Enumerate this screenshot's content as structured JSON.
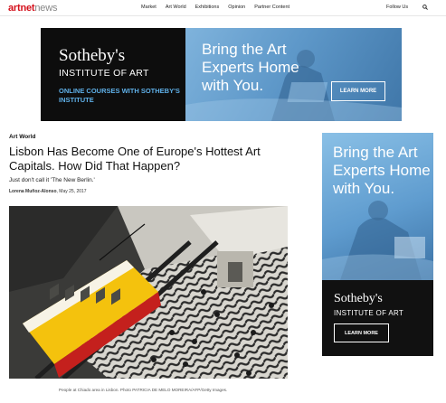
{
  "header": {
    "logo_brand": "artnet",
    "logo_section": "news",
    "nav": [
      "Market",
      "Art World",
      "Exhibitions",
      "Opinion",
      "Partner Content"
    ],
    "follow_label": "Follow Us"
  },
  "banner_ad": {
    "brand": "Sotheby's",
    "brand_sub": "INSTITUTE OF ART",
    "tagline": "ONLINE COURSES WITH SOTHEBY'S INSTITUTE",
    "headline": "Bring the Art Experts Home with You.",
    "cta": "LEARN MORE"
  },
  "article": {
    "section": "Art World",
    "headline": "Lisbon Has Become One of Europe's Hottest Art Capitals. How Did That Happen?",
    "dek": "Just don't call it 'The New Berlin.'",
    "author": "Lorena Muñoz-Alonso",
    "date": ", May 25, 2017",
    "caption": "People at Chiado area in Lisbon. Photo PATRICIA DE MELO MOREIRA/AFP/Getty Images."
  },
  "side_ad": {
    "headline": "Bring the Art Experts Home with You.",
    "brand": "Sotheby's",
    "brand_sub": "INSTITUTE OF ART",
    "cta": "LEARN MORE"
  },
  "colors": {
    "brand_red": "#d4101b",
    "ad_blue": "#5f9ccf",
    "ad_accent": "#5fb0e8"
  },
  "icons": {
    "search": "search-icon"
  }
}
